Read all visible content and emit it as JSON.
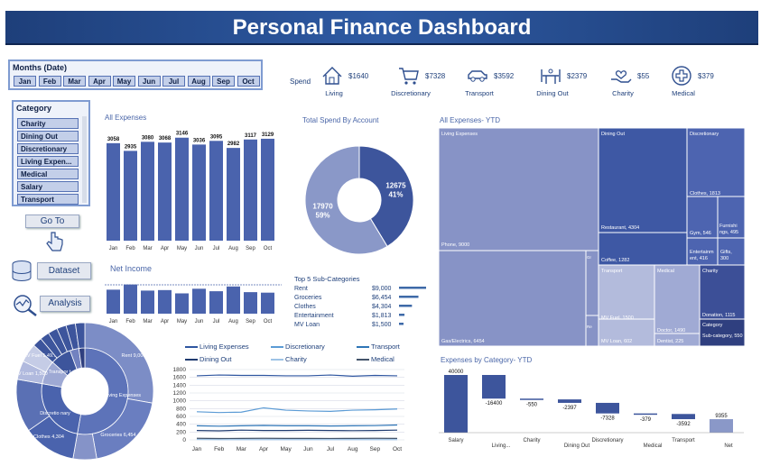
{
  "header": {
    "title": "Personal Finance Dashboard"
  },
  "months_slicer": {
    "title": "Months (Date)",
    "items": [
      "Jan",
      "Feb",
      "Mar",
      "Apr",
      "May",
      "Jun",
      "Jul",
      "Aug",
      "Sep",
      "Oct"
    ]
  },
  "category_slicer": {
    "title": "Category",
    "items": [
      "Charity",
      "Dining Out",
      "Discretionary",
      "Living Expen...",
      "Medical",
      "Salary",
      "Transport"
    ]
  },
  "nav": {
    "goto_label": "Go To",
    "dataset_label": "Dataset",
    "analysis_label": "Analysis"
  },
  "kpis": {
    "label": "Spend",
    "items": [
      {
        "name": "Living",
        "value": "$1640",
        "icon": "house-icon"
      },
      {
        "name": "Discretionary",
        "value": "$7328",
        "icon": "shopping-cart-icon"
      },
      {
        "name": "Transport",
        "value": "$3592",
        "icon": "car-icon"
      },
      {
        "name": "Dining Out",
        "value": "$2379",
        "icon": "dining-table-icon"
      },
      {
        "name": "Charity",
        "value": "$55",
        "icon": "charity-hand-icon"
      },
      {
        "name": "Medical",
        "value": "$379",
        "icon": "medical-cross-icon"
      }
    ]
  },
  "all_expenses": {
    "title": "All Expenses",
    "chart_data": {
      "type": "bar",
      "categories": [
        "Jan",
        "Feb",
        "Mar",
        "Apr",
        "May",
        "Jun",
        "Jul",
        "Aug",
        "Sep",
        "Oct"
      ],
      "values": [
        3058,
        2935,
        3080,
        3068,
        3146,
        3036,
        3095,
        2982,
        3117,
        3129
      ],
      "color": "#4a63ad"
    }
  },
  "net_income": {
    "title": "Net Income",
    "chart_data": {
      "type": "bar",
      "categories": [
        "Jan",
        "Feb",
        "Mar",
        "Apr",
        "May",
        "Jun",
        "Jul",
        "Aug",
        "Sep",
        "Oct"
      ],
      "values": [
        2942,
        3065,
        2920,
        2932,
        2854,
        2964,
        2905,
        3018,
        2883,
        2871
      ],
      "color": "#4a63ad"
    }
  },
  "spend_by_account": {
    "title": "Total Spend By Account",
    "chart_data": {
      "type": "pie",
      "slices": [
        {
          "value": 12675,
          "label": "12675",
          "pct": "41%",
          "color": "#3d559c"
        },
        {
          "value": 17970,
          "label": "17970",
          "pct": "59%",
          "color": "#8a98c8"
        }
      ]
    }
  },
  "top5": {
    "title": "Top 5 Sub-Categories",
    "chart_data": {
      "type": "bar",
      "categories": [
        "Rent",
        "Groceries",
        "Clothes",
        "Entertainment",
        "MV Loan"
      ],
      "values": [
        9000,
        6454,
        4304,
        1813,
        1500
      ],
      "labels": [
        "$9,000",
        "$6,454",
        "$4,304",
        "$1,813",
        "$1,500"
      ]
    }
  },
  "treemap": {
    "title": "All Expenses- YTD",
    "labels": {
      "living": "Living Expenses",
      "phone": "Phone, 9000",
      "gas": "Gas/Electrics, 6454",
      "re": "Re... 1...",
      "gr": "Gr oc eri es, 40 0",
      "dining": "Dining Out",
      "restaurant": "Restaurant, 4304",
      "coffee": "Coffee, 1282",
      "transport": "Transport",
      "mvfuel": "MV Fuel, 1500",
      "mvloan": "MV Loan, 602",
      "medical": "Medical",
      "doctor": "Doctor, 1490",
      "dentist": "Dentist, 225",
      "discretionary": "Discretionary",
      "clothes": "Clothes, 1813",
      "gym": "Gym, 546",
      "furnish": "Furnishi ngs, 495",
      "entertain": "Entertainm ent, 416",
      "gifts": "Gifts, 300",
      "charity": "Charity",
      "donation": "Donation, 1115",
      "legend_cat": "Category",
      "legend_sub": "Sub-category, 550"
    }
  },
  "sunburst": {
    "labels": {
      "rent": "Rent 9,000",
      "living": "Living Expenses",
      "groceries": "Groceries 6,454",
      "clothes": "Clothes 4,304",
      "discret": "Discretio nary",
      "transport": "Transpor t",
      "mvfuel": "MV Fuel 1,49...",
      "mvloan": "MV Loan 1,500"
    }
  },
  "line_chart": {
    "legend": [
      "Living Expenses",
      "Discretionary",
      "Transport",
      "Dining Out",
      "Charity",
      "Medical"
    ],
    "chart_data": {
      "type": "line",
      "x": [
        "Jan",
        "Feb",
        "Mar",
        "Apr",
        "May",
        "Jun",
        "Jul",
        "Aug",
        "Sep",
        "Oct"
      ],
      "ylim": [
        0,
        1800
      ],
      "yticks": [
        "0",
        "200",
        "400",
        "600",
        "800",
        "1000",
        "1200",
        "1400",
        "1600",
        "1800"
      ],
      "series": [
        {
          "name": "Living Expenses",
          "color": "#2f56a0",
          "values": [
            1640,
            1660,
            1650,
            1650,
            1640,
            1640,
            1660,
            1630,
            1650,
            1640
          ]
        },
        {
          "name": "Discretionary",
          "color": "#5b9bd5",
          "values": [
            720,
            700,
            710,
            820,
            760,
            740,
            730,
            760,
            770,
            790
          ]
        },
        {
          "name": "Transport",
          "color": "#2e75b6",
          "values": [
            360,
            350,
            360,
            370,
            360,
            360,
            355,
            360,
            365,
            380
          ]
        },
        {
          "name": "Dining Out",
          "color": "#1f3b70",
          "values": [
            240,
            230,
            250,
            240,
            240,
            245,
            240,
            235,
            240,
            250
          ]
        },
        {
          "name": "Charity",
          "color": "#9dc3e6",
          "values": [
            10,
            5,
            5,
            5,
            5,
            5,
            5,
            5,
            5,
            5
          ]
        },
        {
          "name": "Medical",
          "color": "#44546a",
          "values": [
            40,
            35,
            38,
            40,
            37,
            38,
            36,
            38,
            40,
            37
          ]
        }
      ]
    }
  },
  "waterfall": {
    "title": "Expenses by Category- YTD",
    "chart_data": {
      "type": "bar",
      "categories": [
        "Salary",
        "Living...",
        "Charity",
        "Dining Out",
        "Discretionary",
        "Medical",
        "Transport",
        "Net"
      ],
      "values": [
        40000,
        -16400,
        -550,
        -2397,
        -7328,
        -379,
        -3592,
        9355
      ],
      "labels": [
        "40000",
        "-16400",
        "-550",
        "-2397",
        "-7328",
        "-379",
        "-3592",
        "9355"
      ]
    }
  }
}
